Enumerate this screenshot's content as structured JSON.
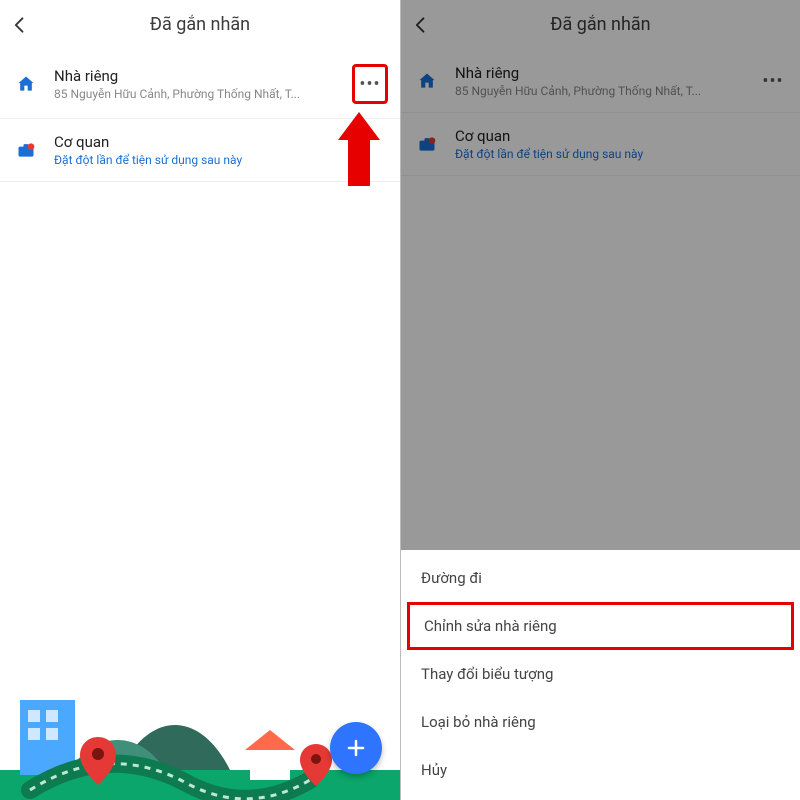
{
  "header": {
    "title": "Đã gắn nhãn"
  },
  "items": {
    "home": {
      "title": "Nhà riêng",
      "sub": "85 Nguyễn Hữu Cảnh, Phường Thống Nhất, T..."
    },
    "work": {
      "title": "Cơ quan",
      "sub": "Đặt đột lần để tiện sử dụng sau này"
    }
  },
  "more_glyph": "•••",
  "sheet": {
    "directions": "Đường đi",
    "edit": "Chỉnh sửa nhà riêng",
    "change_icon": "Thay đổi biểu tượng",
    "remove": "Loại bỏ nhà riêng",
    "cancel": "Hủy"
  }
}
